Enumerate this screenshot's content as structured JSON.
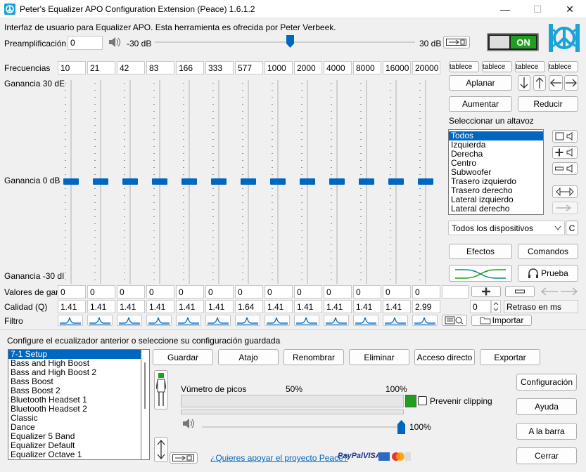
{
  "window": {
    "title": "Peter's Equalizer APO Configuration Extension (Peace) 1.6.1.2",
    "minimize": "—",
    "maximize": "☐",
    "close": "✕"
  },
  "header": {
    "description": "Interfaz de usuario para Equalizer APO. Esta herramienta es ofrecida por Peter Verbeek.",
    "power_label": "ON"
  },
  "preamp": {
    "label": "Preamplificación",
    "value": "0",
    "min_label": "-30 dB",
    "max_label": "30 dB",
    "level_fraction": 0.52
  },
  "freq": {
    "label": "Frecuencias",
    "values": [
      "10",
      "21",
      "42",
      "83",
      "166",
      "333",
      "577",
      "1000",
      "2000",
      "4000",
      "8000",
      "16000",
      "20000"
    ]
  },
  "table_buttons": [
    "tablece",
    "tablece",
    "tablece",
    "tablece"
  ],
  "gain_labels": {
    "top": "Ganancia 30 dE",
    "mid": "Ganancia 0 dB",
    "bottom": "Ganancia -30 dI"
  },
  "band_levels": [
    0,
    0,
    0,
    0,
    0,
    0,
    0,
    0,
    0,
    0,
    0,
    0,
    0
  ],
  "gain_values": {
    "label": "Valores de gana",
    "values": [
      "0",
      "0",
      "0",
      "0",
      "0",
      "0",
      "0",
      "0",
      "0",
      "0",
      "0",
      "0",
      "0"
    ]
  },
  "quality": {
    "label": "Calidad (Q)",
    "values": [
      "1.41",
      "1.41",
      "1.41",
      "1.41",
      "1.41",
      "1.41",
      "1.64",
      "1.41",
      "1.41",
      "1.41",
      "1.41",
      "1.41",
      "2.99"
    ]
  },
  "filter": {
    "label": "Filtro"
  },
  "buttons": {
    "aplanar": "Aplanar",
    "aumentar": "Aumentar",
    "reducir": "Reducir",
    "efectos": "Efectos",
    "comandos": "Comandos",
    "prueba": "Prueba",
    "importar": "Importar",
    "guardar": "Guardar",
    "atajo": "Atajo",
    "renombrar": "Renombrar",
    "eliminar": "Eliminar",
    "acceso_directo": "Acceso directo",
    "exportar": "Exportar",
    "configuracion": "Configuración",
    "ayuda": "Ayuda",
    "a_la_barra": "A la barra",
    "cerrar": "Cerrar",
    "c_button": "C"
  },
  "speaker": {
    "label": "Seleccionar un altavoz",
    "items": [
      "Todos",
      "Izquierda",
      "Derecha",
      "Centro",
      "Subwoofer",
      "Trasero izquierdo",
      "Trasero derecho",
      "Lateral izquierdo",
      "Lateral derecho"
    ],
    "selected": 0,
    "device": "Todos los dispositivos"
  },
  "delay": {
    "value": "0",
    "label": "Retraso en ms"
  },
  "config": {
    "label": "Configure el ecualizador anterior o seleccione su configuración guardada",
    "items": [
      "7-1 Setup",
      "Bass and High Boost",
      "Bass and High Boost 2",
      "Bass Boost",
      "Bass Boost 2",
      "Bluetooth Headset 1",
      "Bluetooth Headset 2",
      "Classic",
      "Dance",
      "Equalizer 5 Band",
      "Equalizer Default",
      "Equalizer Octave 1"
    ],
    "selected": 0
  },
  "meter": {
    "title": "Vúmetro de picos",
    "mark50": "50%",
    "mark100": "100%",
    "prevent_clipping": "Prevenir clipping",
    "volume": "100%",
    "volume_fraction": 1.0
  },
  "support": {
    "link": "¿Quieres apoyar el proyecto Peace?",
    "paypal": "PayPal",
    "visa": "VISA"
  },
  "colors": {
    "accent": "#0067c0",
    "power_green": "#1ea01e"
  }
}
